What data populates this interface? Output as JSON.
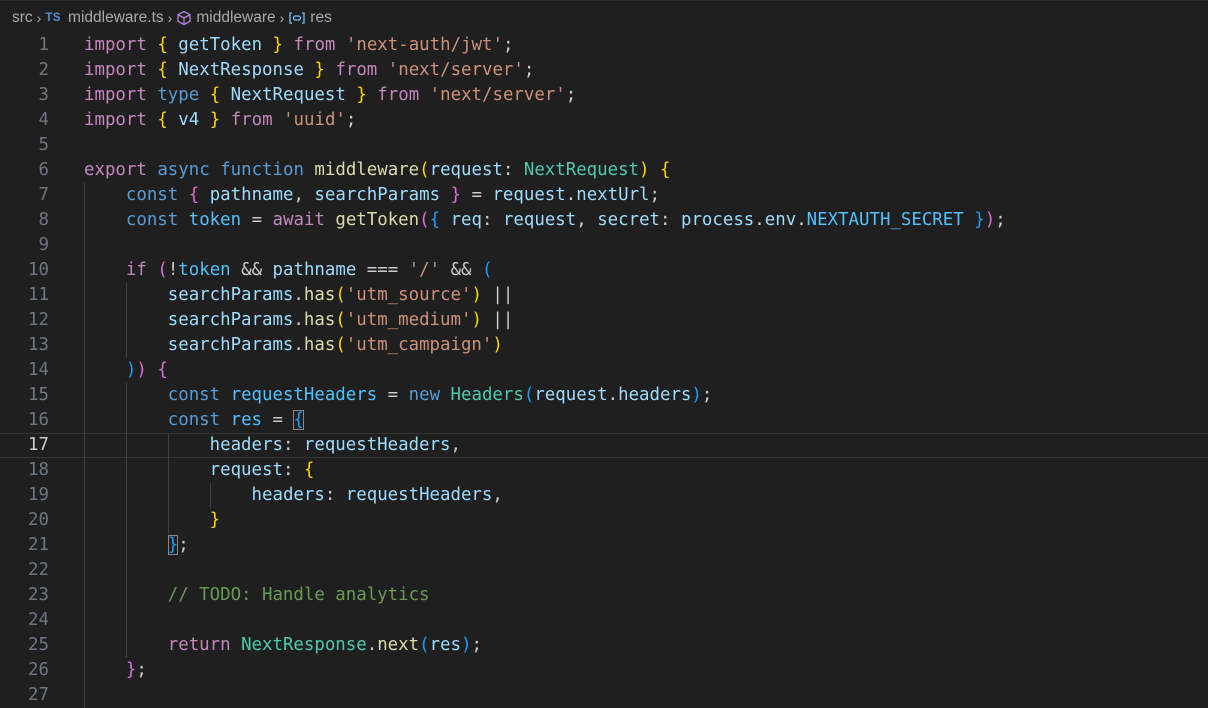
{
  "breadcrumb": {
    "folder": "src",
    "file_badge": "TS",
    "file": "middleware.ts",
    "symbol": "middleware",
    "variable": "res"
  },
  "editor": {
    "current_line": 17,
    "lines": [
      [
        [
          "ctl",
          "import"
        ],
        [
          "p",
          " "
        ],
        [
          "b1",
          "{"
        ],
        [
          "p",
          " "
        ],
        [
          "var",
          "getToken"
        ],
        [
          "p",
          " "
        ],
        [
          "b1",
          "}"
        ],
        [
          "p",
          " "
        ],
        [
          "ctl",
          "from"
        ],
        [
          "p",
          " "
        ],
        [
          "str",
          "'next-auth/jwt'"
        ],
        [
          "p",
          ";"
        ]
      ],
      [
        [
          "ctl",
          "import"
        ],
        [
          "p",
          " "
        ],
        [
          "b1",
          "{"
        ],
        [
          "p",
          " "
        ],
        [
          "var",
          "NextResponse"
        ],
        [
          "p",
          " "
        ],
        [
          "b1",
          "}"
        ],
        [
          "p",
          " "
        ],
        [
          "ctl",
          "from"
        ],
        [
          "p",
          " "
        ],
        [
          "str",
          "'next/server'"
        ],
        [
          "p",
          ";"
        ]
      ],
      [
        [
          "ctl",
          "import"
        ],
        [
          "p",
          " "
        ],
        [
          "kw",
          "type"
        ],
        [
          "p",
          " "
        ],
        [
          "b1",
          "{"
        ],
        [
          "p",
          " "
        ],
        [
          "var",
          "NextRequest"
        ],
        [
          "p",
          " "
        ],
        [
          "b1",
          "}"
        ],
        [
          "p",
          " "
        ],
        [
          "ctl",
          "from"
        ],
        [
          "p",
          " "
        ],
        [
          "str",
          "'next/server'"
        ],
        [
          "p",
          ";"
        ]
      ],
      [
        [
          "ctl",
          "import"
        ],
        [
          "p",
          " "
        ],
        [
          "b1",
          "{"
        ],
        [
          "p",
          " "
        ],
        [
          "var",
          "v4"
        ],
        [
          "p",
          " "
        ],
        [
          "b1",
          "}"
        ],
        [
          "p",
          " "
        ],
        [
          "ctl",
          "from"
        ],
        [
          "p",
          " "
        ],
        [
          "str",
          "'uuid'"
        ],
        [
          "p",
          ";"
        ]
      ],
      [],
      [
        [
          "ctl",
          "export"
        ],
        [
          "p",
          " "
        ],
        [
          "kw",
          "async"
        ],
        [
          "p",
          " "
        ],
        [
          "kw",
          "function"
        ],
        [
          "p",
          " "
        ],
        [
          "fn",
          "middleware"
        ],
        [
          "b1",
          "("
        ],
        [
          "var",
          "request"
        ],
        [
          "p",
          ": "
        ],
        [
          "typ",
          "NextRequest"
        ],
        [
          "b1",
          ")"
        ],
        [
          "p",
          " "
        ],
        [
          "b1",
          "{"
        ]
      ],
      [
        [
          "p",
          "    "
        ],
        [
          "kw",
          "const"
        ],
        [
          "p",
          " "
        ],
        [
          "b2",
          "{"
        ],
        [
          "p",
          " "
        ],
        [
          "var",
          "pathname"
        ],
        [
          "p",
          ", "
        ],
        [
          "var",
          "searchParams"
        ],
        [
          "p",
          " "
        ],
        [
          "b2",
          "}"
        ],
        [
          "p",
          " = "
        ],
        [
          "var",
          "request"
        ],
        [
          "p",
          "."
        ],
        [
          "var",
          "nextUrl"
        ],
        [
          "p",
          ";"
        ]
      ],
      [
        [
          "p",
          "    "
        ],
        [
          "kw",
          "const"
        ],
        [
          "p",
          " "
        ],
        [
          "cst",
          "token"
        ],
        [
          "p",
          " = "
        ],
        [
          "ctl",
          "await"
        ],
        [
          "p",
          " "
        ],
        [
          "fn",
          "getToken"
        ],
        [
          "b2",
          "("
        ],
        [
          "b3",
          "{"
        ],
        [
          "p",
          " "
        ],
        [
          "var",
          "req"
        ],
        [
          "p",
          ": "
        ],
        [
          "var",
          "request"
        ],
        [
          "p",
          ", "
        ],
        [
          "var",
          "secret"
        ],
        [
          "p",
          ": "
        ],
        [
          "var",
          "process"
        ],
        [
          "p",
          "."
        ],
        [
          "var",
          "env"
        ],
        [
          "p",
          "."
        ],
        [
          "cst",
          "NEXTAUTH_SECRET"
        ],
        [
          "p",
          " "
        ],
        [
          "b3",
          "}"
        ],
        [
          "b2",
          ")"
        ],
        [
          "p",
          ";"
        ]
      ],
      [],
      [
        [
          "p",
          "    "
        ],
        [
          "ctl",
          "if"
        ],
        [
          "p",
          " "
        ],
        [
          "b2",
          "("
        ],
        [
          "p",
          "!"
        ],
        [
          "cst",
          "token"
        ],
        [
          "p",
          " && "
        ],
        [
          "var",
          "pathname"
        ],
        [
          "p",
          " === "
        ],
        [
          "str",
          "'/'"
        ],
        [
          "p",
          " && "
        ],
        [
          "b3",
          "("
        ]
      ],
      [
        [
          "p",
          "        "
        ],
        [
          "var",
          "searchParams"
        ],
        [
          "p",
          "."
        ],
        [
          "fn",
          "has"
        ],
        [
          "b1",
          "("
        ],
        [
          "str",
          "'utm_source'"
        ],
        [
          "b1",
          ")"
        ],
        [
          "p",
          " ||"
        ]
      ],
      [
        [
          "p",
          "        "
        ],
        [
          "var",
          "searchParams"
        ],
        [
          "p",
          "."
        ],
        [
          "fn",
          "has"
        ],
        [
          "b1",
          "("
        ],
        [
          "str",
          "'utm_medium'"
        ],
        [
          "b1",
          ")"
        ],
        [
          "p",
          " ||"
        ]
      ],
      [
        [
          "p",
          "        "
        ],
        [
          "var",
          "searchParams"
        ],
        [
          "p",
          "."
        ],
        [
          "fn",
          "has"
        ],
        [
          "b1",
          "("
        ],
        [
          "str",
          "'utm_campaign'"
        ],
        [
          "b1",
          ")"
        ]
      ],
      [
        [
          "p",
          "    "
        ],
        [
          "b3",
          ")"
        ],
        [
          "b2",
          ")"
        ],
        [
          "p",
          " "
        ],
        [
          "b2",
          "{"
        ]
      ],
      [
        [
          "p",
          "        "
        ],
        [
          "kw",
          "const"
        ],
        [
          "p",
          " "
        ],
        [
          "cst",
          "requestHeaders"
        ],
        [
          "p",
          " = "
        ],
        [
          "kw",
          "new"
        ],
        [
          "p",
          " "
        ],
        [
          "typ",
          "Headers"
        ],
        [
          "b3",
          "("
        ],
        [
          "var",
          "request"
        ],
        [
          "p",
          "."
        ],
        [
          "var",
          "headers"
        ],
        [
          "b3",
          ")"
        ],
        [
          "p",
          ";"
        ]
      ],
      [
        [
          "p",
          "        "
        ],
        [
          "kw",
          "const"
        ],
        [
          "p",
          " "
        ],
        [
          "cst",
          "res"
        ],
        [
          "p",
          " = "
        ],
        [
          "b3bm",
          "{"
        ]
      ],
      [
        [
          "p",
          "            "
        ],
        [
          "var",
          "headers"
        ],
        [
          "p",
          ": "
        ],
        [
          "var",
          "requestHeaders"
        ],
        [
          "p",
          ","
        ]
      ],
      [
        [
          "p",
          "            "
        ],
        [
          "var",
          "request"
        ],
        [
          "p",
          ": "
        ],
        [
          "b1",
          "{"
        ]
      ],
      [
        [
          "p",
          "                "
        ],
        [
          "var",
          "headers"
        ],
        [
          "p",
          ": "
        ],
        [
          "var",
          "requestHeaders"
        ],
        [
          "p",
          ","
        ]
      ],
      [
        [
          "p",
          "            "
        ],
        [
          "b1",
          "}"
        ]
      ],
      [
        [
          "p",
          "        "
        ],
        [
          "b3bm",
          "}"
        ],
        [
          "p",
          ";"
        ]
      ],
      [],
      [
        [
          "p",
          "        "
        ],
        [
          "cmt",
          "// TODO: Handle analytics"
        ]
      ],
      [],
      [
        [
          "p",
          "        "
        ],
        [
          "ctl",
          "return"
        ],
        [
          "p",
          " "
        ],
        [
          "typ",
          "NextResponse"
        ],
        [
          "p",
          "."
        ],
        [
          "fn",
          "next"
        ],
        [
          "b3",
          "("
        ],
        [
          "var",
          "res"
        ],
        [
          "b3",
          ")"
        ],
        [
          "p",
          ";"
        ]
      ],
      [
        [
          "p",
          "    "
        ],
        [
          "b2",
          "}"
        ],
        [
          "p",
          ";"
        ]
      ],
      []
    ]
  }
}
